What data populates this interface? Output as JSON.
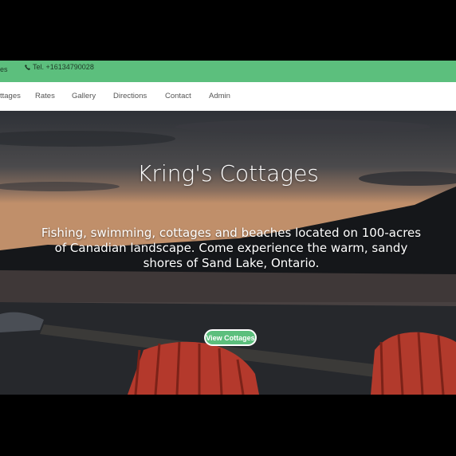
{
  "topbar": {
    "left_fragment": "es",
    "phone_label": "Tel. +16134790028",
    "phone_icon": "phone-icon",
    "color": "#5cbf7d"
  },
  "nav": {
    "items": [
      "ttages",
      "Rates",
      "Gallery",
      "Directions",
      "Contact",
      "Admin"
    ]
  },
  "hero": {
    "title": "Kring's Cottages",
    "description": "Fishing, swimming, cottages and beaches located on 100-acres of Canadian landscape. Come experience the warm, sandy shores of Sand Lake, Ontario.",
    "cta_label": "View Cottages",
    "cta_color": "#5cbf7d"
  }
}
